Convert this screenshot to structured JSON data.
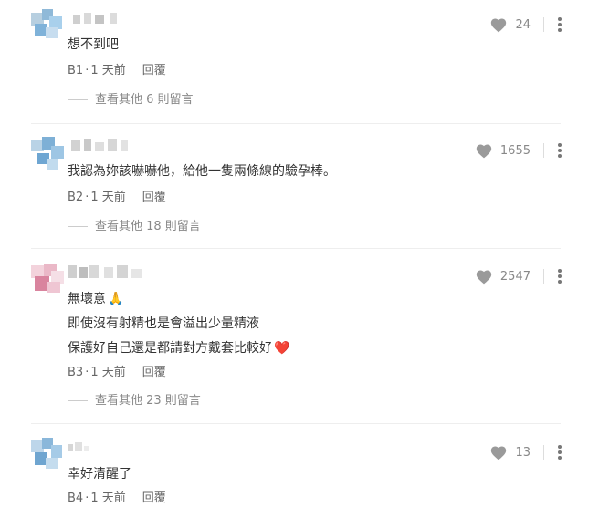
{
  "comments": [
    {
      "lines": [
        "想不到吧"
      ],
      "floor": "B1",
      "time": "1 天前",
      "reply_label": "回覆",
      "likes": "24",
      "replies": "查看其他 6 則留言"
    },
    {
      "lines": [
        "我認為妳該嚇嚇他，給他一隻兩條線的驗孕棒。"
      ],
      "floor": "B2",
      "time": "1 天前",
      "reply_label": "回覆",
      "likes": "1655",
      "replies": "查看其他 18 則留言"
    },
    {
      "lines": [
        "無壞意",
        "即使沒有射精也是會溢出少量精液",
        "保護好自己還是都請對方戴套比較好"
      ],
      "floor": "B3",
      "time": "1 天前",
      "reply_label": "回覆",
      "likes": "2547",
      "replies": "查看其他 23 則留言"
    },
    {
      "lines": [
        "幸好清醒了"
      ],
      "floor": "B4",
      "time": "1 天前",
      "reply_label": "回覆",
      "likes": "13"
    }
  ],
  "separator": "·",
  "emoji": {
    "pray": "🙏",
    "heart": "❤️"
  },
  "icons": {
    "like": "heart-icon",
    "more": "more-vertical-icon"
  },
  "colors": {
    "heart_icon": "#9a9a9a",
    "emoji_heart": "#e83b4f"
  }
}
